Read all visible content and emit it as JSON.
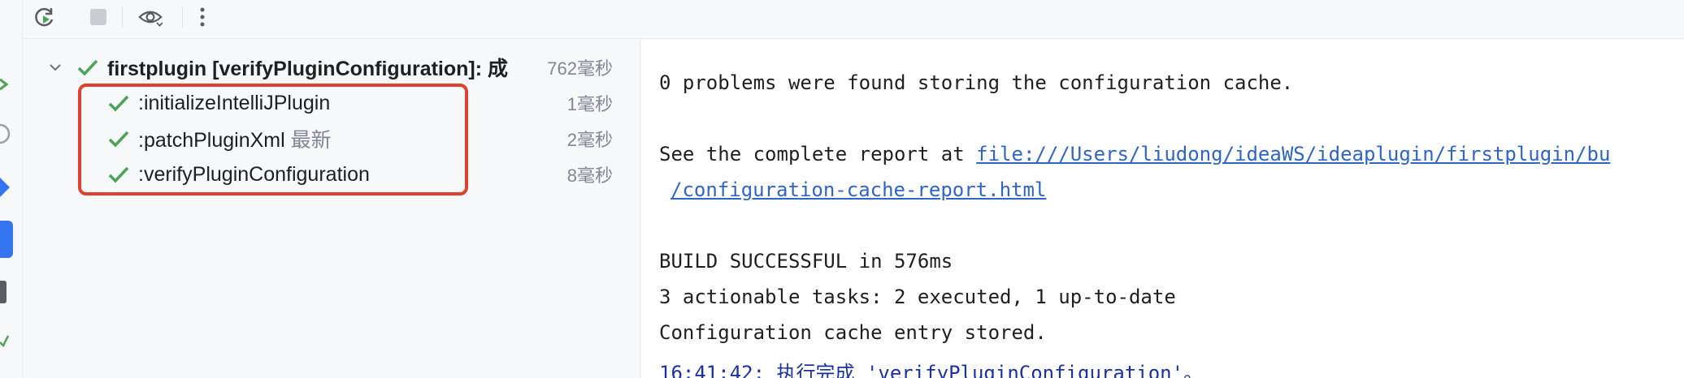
{
  "toolbar": {
    "rerun_icon": "rerun-icon",
    "stop_icon": "stop-icon",
    "view_icon": "eye-icon",
    "more_icon": "more-vertical-icon"
  },
  "tree": {
    "root": {
      "label": "firstplugin [verifyPluginConfiguration]: 成",
      "time": "762毫秒"
    },
    "tasks": [
      {
        "label": ":initializeIntelliJPlugin",
        "suffix": "",
        "time": "1毫秒"
      },
      {
        "label": ":patchPluginXml",
        "suffix": "最新",
        "time": "2毫秒"
      },
      {
        "label": ":verifyPluginConfiguration",
        "suffix": "",
        "time": "8毫秒"
      }
    ]
  },
  "console": {
    "line1": "0 problems were found storing the configuration cache.",
    "line2_prefix": "See the complete report at ",
    "line2_link": "file:///Users/liudong/ideaWS/ideaplugin/firstplugin/bu",
    "line3_link": "/configuration-cache-report.html",
    "line4": "BUILD SUCCESSFUL in 576ms",
    "line5": "3 actionable tasks: 2 executed, 1 up-to-date",
    "line6": "Configuration cache entry stored.",
    "line7": "16:41:42: 执行完成 'verifyPluginConfiguration'。"
  },
  "colors": {
    "success_green": "#4aa357",
    "highlight_red": "#e0402f",
    "link_blue": "#2f65ca",
    "status_blue": "#1a31a6"
  }
}
